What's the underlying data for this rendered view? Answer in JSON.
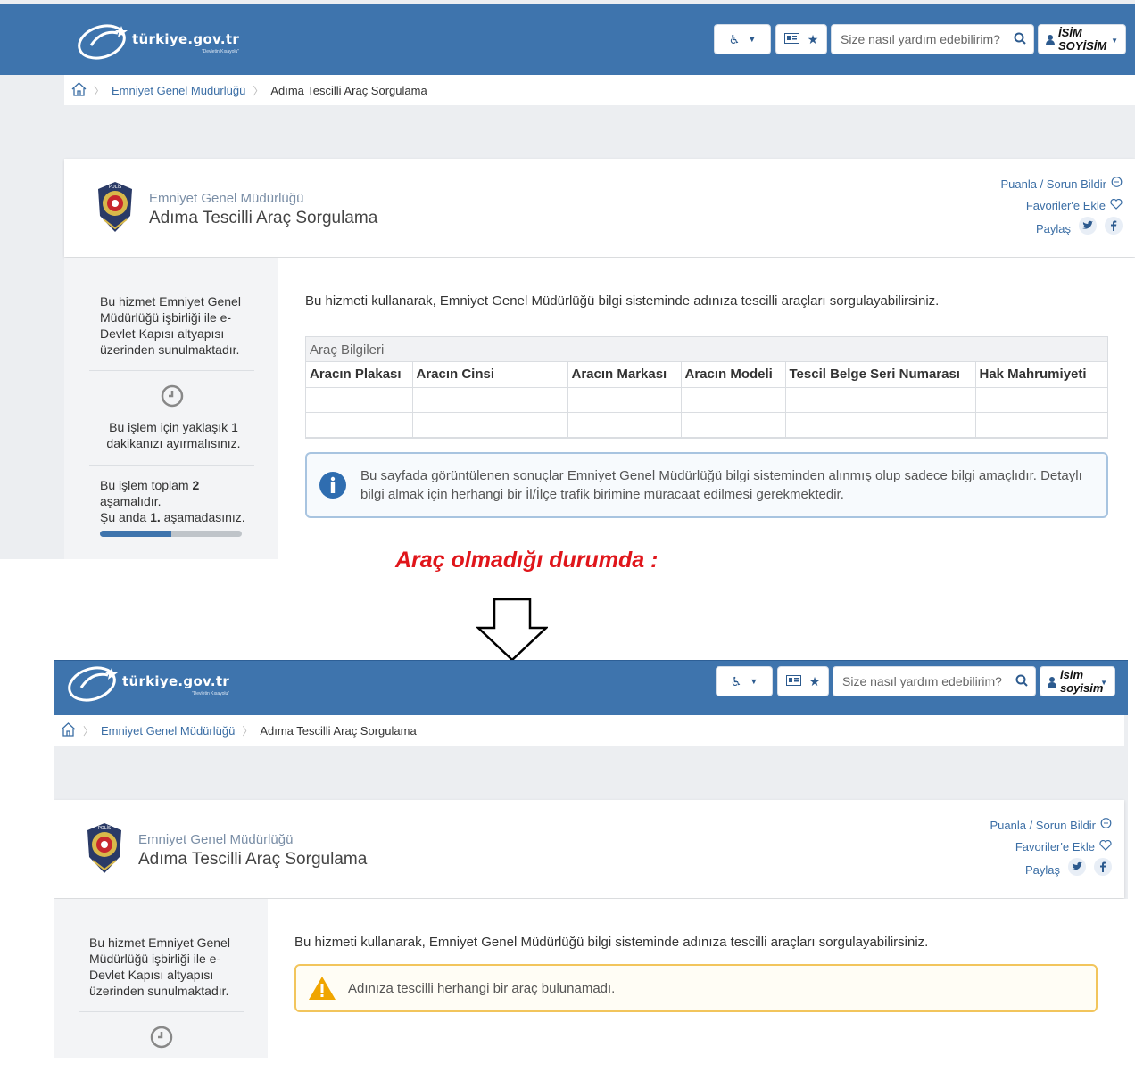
{
  "header": {
    "logo_text": "türkiye.gov.tr",
    "logo_sub": "\"Devletin Kısayolu\"",
    "search_placeholder": "Size nasıl yardım edebilirim?",
    "user_line1_top": "İSİM",
    "user_line2_top": "SOYİSİM",
    "user_line1_bottom": "isim",
    "user_line2_bottom": "soyisim"
  },
  "breadcrumb": {
    "org": "Emniyet Genel Müdürlüğü",
    "current": "Adıma Tescilli Araç Sorgulama"
  },
  "service": {
    "org": "Emniyet Genel Müdürlüğü",
    "title": "Adıma Tescilli Araç Sorgulama",
    "rate": "Puanla / Sorun Bildir",
    "favorite": "Favoriler'e Ekle",
    "share": "Paylaş"
  },
  "sidebar": {
    "provider_text": "Bu hizmet Emniyet Genel Müdürlüğü işbirliği ile e-Devlet Kapısı altyapısı üzerinden sunulmaktadır.",
    "time_text": "Bu işlem için yaklaşık 1 dakikanızı ayırmalısınız.",
    "steps_pre": "Bu işlem toplam",
    "steps_total": "2",
    "steps_mid": "aşamalıdır.",
    "steps_now_pre": "Şu anda",
    "steps_now": "1.",
    "steps_post": "aşamadasınız.",
    "progress": 0.5
  },
  "main": {
    "intro": "Bu hizmeti kullanarak, Emniyet Genel Müdürlüğü bilgi sisteminde adınıza tescilli araçları sorgulayabilirsiniz.",
    "table_title": "Araç Bilgileri",
    "columns": [
      "Aracın Plakası",
      "Aracın Cinsi",
      "Aracın Markası",
      "Aracın Modeli",
      "Tescil Belge Seri Numarası",
      "Hak Mahrumiyeti"
    ],
    "info": "Bu sayfada görüntülenen sonuçlar Emniyet Genel Müdürlüğü bilgi sisteminden alınmış olup sadece bilgi amaçlıdır. Detaylı bilgi almak için herhangi bir İl/İlçe trafik birimine müracaat edilmesi gerekmektedir.",
    "warning": "Adınıza tescilli herhangi bir araç bulunamadı."
  },
  "annotation": {
    "note": "Araç olmadığı durumda :"
  },
  "colors": {
    "brand_blue": "#3e74ad",
    "link_blue": "#3b6ea5",
    "note_red": "#e0161b",
    "warn_border": "#f2c55c"
  }
}
